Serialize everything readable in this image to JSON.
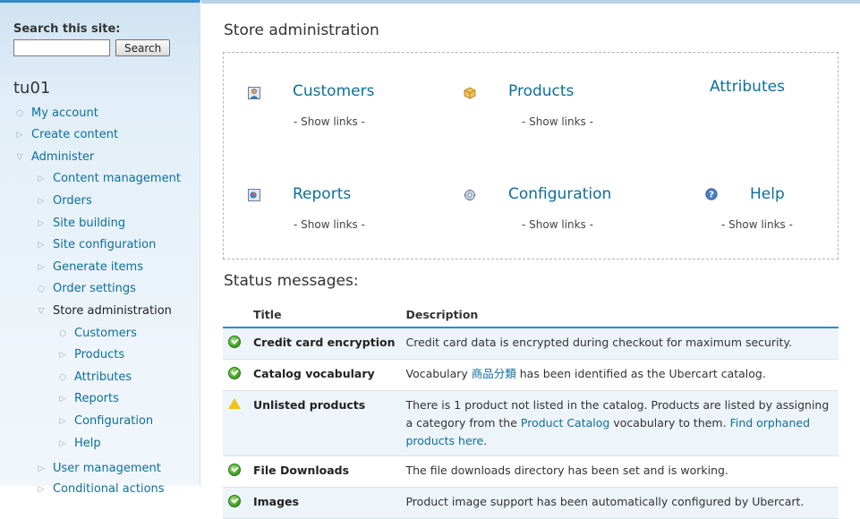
{
  "search": {
    "label": "Search this site:",
    "placeholder": "",
    "button": "Search"
  },
  "sidebar": {
    "user_title": "tu01",
    "items": [
      {
        "label": "My account"
      },
      {
        "label": "Create content"
      },
      {
        "label": "Administer"
      },
      {
        "label": "Content management"
      },
      {
        "label": "Orders"
      },
      {
        "label": "Site building"
      },
      {
        "label": "Site configuration"
      },
      {
        "label": "Generate items"
      },
      {
        "label": "Order settings"
      },
      {
        "label": "Store administration"
      },
      {
        "label": "Customers"
      },
      {
        "label": "Products"
      },
      {
        "label": "Attributes"
      },
      {
        "label": "Reports"
      },
      {
        "label": "Configuration"
      },
      {
        "label": "Help"
      },
      {
        "label": "User management"
      },
      {
        "label": "Conditional actions"
      }
    ]
  },
  "main": {
    "title": "Store administration",
    "cells": [
      {
        "title": "Customers",
        "links": "- Show links -",
        "icon": "customers-icon"
      },
      {
        "title": "Products",
        "links": "- Show links -",
        "icon": "products-icon"
      },
      {
        "title": "Attributes",
        "links": "",
        "icon": ""
      },
      {
        "title": "Reports",
        "links": "- Show links -",
        "icon": "reports-icon"
      },
      {
        "title": "Configuration",
        "links": "- Show links -",
        "icon": "configuration-icon"
      },
      {
        "title": "Help",
        "links": "- Show links -",
        "icon": "help-icon"
      }
    ],
    "status_heading": "Status messages:",
    "table": {
      "headers": [
        "Title",
        "Description"
      ],
      "rows": [
        {
          "status": "ok",
          "title": "Credit card encryption",
          "description": "Credit card data is encrypted during checkout for maximum security."
        },
        {
          "status": "ok",
          "title": "Catalog vocabulary",
          "desc_pre": "Vocabulary ",
          "desc_link": "商品分類",
          "desc_post": " has been identified as the Ubercart catalog."
        },
        {
          "status": "warning",
          "title": "Unlisted products",
          "desc_pre": "There is 1 product not listed in the catalog. Products are listed by assigning a category from the ",
          "desc_link": "Product Catalog",
          "desc_mid": " vocabulary to them. ",
          "desc_link2": "Find orphaned products here",
          "desc_post": "."
        },
        {
          "status": "ok",
          "title": "File Downloads",
          "description": "The file downloads directory has been set and is working."
        },
        {
          "status": "ok",
          "title": "Images",
          "description": "Product image support has been automatically configured by Ubercart."
        }
      ]
    }
  },
  "colors": {
    "link": "#0d6f99",
    "accent": "#2f8ad0",
    "ok": "#3c9a1e",
    "warning": "#f0c419"
  }
}
